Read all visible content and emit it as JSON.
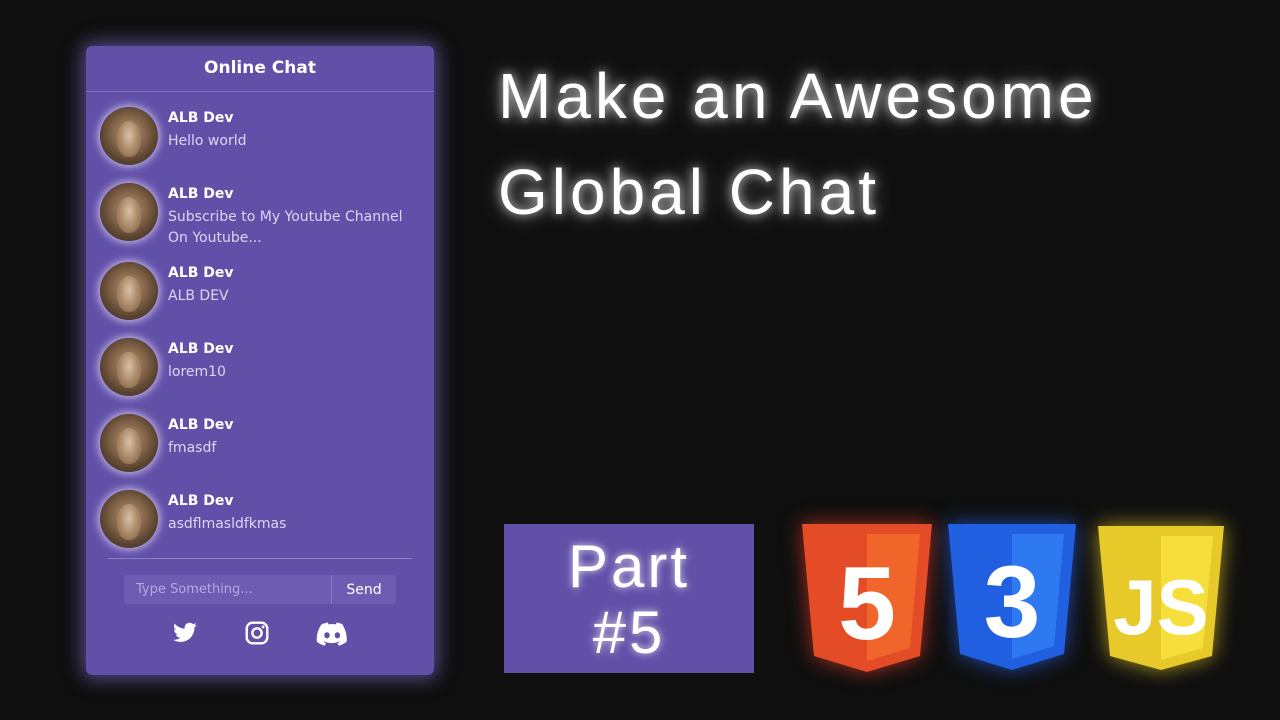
{
  "chat": {
    "title": "Online Chat",
    "messages": [
      {
        "name": "ALB Dev",
        "text": "Hello world"
      },
      {
        "name": "ALB Dev",
        "text": "Subscribe to My Youtube Channel On Youtube..."
      },
      {
        "name": "ALB Dev",
        "text": "ALB DEV"
      },
      {
        "name": "ALB Dev",
        "text": "lorem10"
      },
      {
        "name": "ALB Dev",
        "text": "fmasdf"
      },
      {
        "name": "ALB Dev",
        "text": "asdflmasldfkmas"
      }
    ],
    "input_placeholder": "Type Something...",
    "send_label": "Send",
    "socials": [
      "twitter-icon",
      "instagram-icon",
      "discord-icon"
    ]
  },
  "headline": {
    "line1": "Make an Awesome",
    "line2": "Global Chat"
  },
  "part": {
    "line1": "Part",
    "line2": "#5"
  },
  "logos": {
    "html_digit": "5",
    "css_digit": "3",
    "js_text": "JS"
  },
  "colors": {
    "panel": "#6150a8",
    "background": "#0f0f0f",
    "html": "#e34c26",
    "css": "#2965f1",
    "js": "#f0db4f"
  }
}
